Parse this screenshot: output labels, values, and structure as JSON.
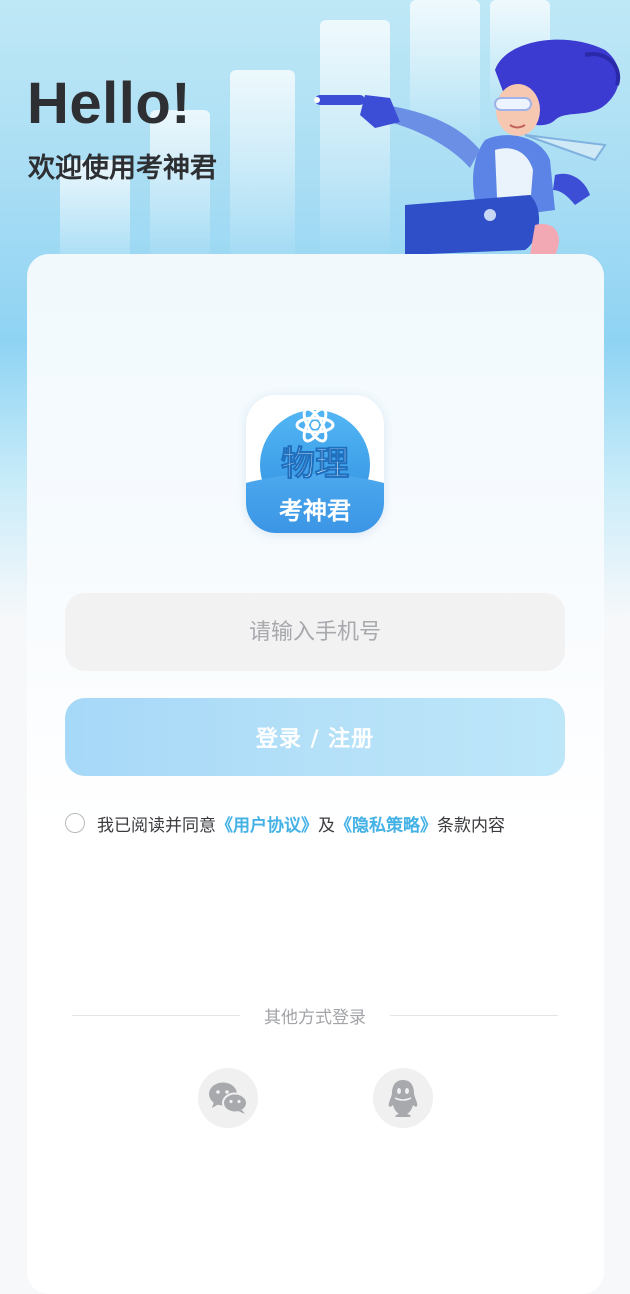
{
  "header": {
    "hello": "Hello!",
    "welcome": "欢迎使用考神君"
  },
  "logo": {
    "subject": "物理",
    "brand": "考神君"
  },
  "phone": {
    "placeholder": "请输入手机号",
    "value": ""
  },
  "login_button": {
    "label": "登录 / 注册"
  },
  "agreement": {
    "prefix": "我已阅读并同意",
    "user_agreement": "《用户协议》",
    "and": "及",
    "privacy_policy": "《隐私策略》",
    "suffix": "条款内容",
    "checked": false
  },
  "other_login": {
    "label": "其他方式登录",
    "methods": [
      "wechat-icon",
      "qq-icon"
    ]
  },
  "colors": {
    "accent": "#45b2e6",
    "button": "#b4e0f8",
    "text": "#2d2f33"
  }
}
